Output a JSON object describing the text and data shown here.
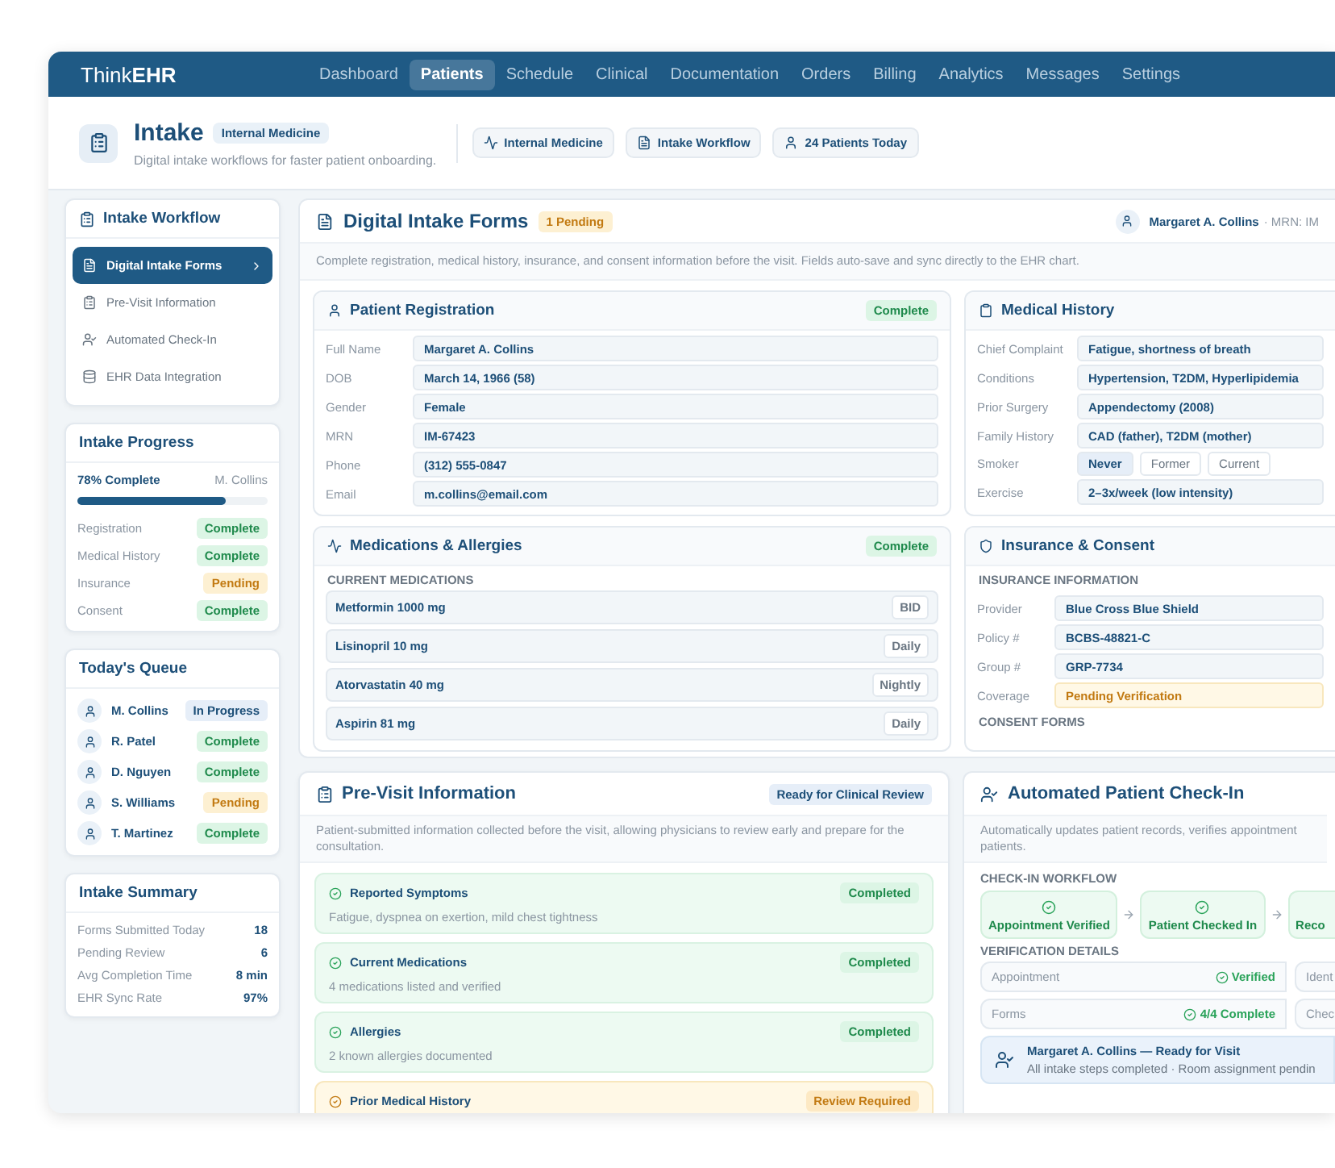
{
  "brand": "Think**EHR**",
  "nav": [
    {
      "label": "Dashboard",
      "selected": false
    },
    {
      "label": "Patients",
      "selected": true
    },
    {
      "label": "Schedule",
      "selected": false
    },
    {
      "label": "Clinical",
      "selected": false
    },
    {
      "label": "Documentation",
      "selected": false
    },
    {
      "label": "Orders",
      "selected": false
    },
    {
      "label": "Billing",
      "selected": false
    },
    {
      "label": "Analytics",
      "selected": false
    },
    {
      "label": "Messages",
      "selected": false
    },
    {
      "label": "Settings",
      "selected": false
    }
  ],
  "header": {
    "title": "Intake",
    "badge": "Internal Medicine",
    "subtitle": "Digital intake workflows for faster patient onboarding.",
    "pills": [
      {
        "kind": "pulse",
        "label": "Internal Medicine"
      },
      {
        "kind": "document",
        "label": "Intake Workflow"
      },
      {
        "kind": "person",
        "label": "24 Patients Today"
      }
    ]
  },
  "sidebar": {
    "workflow": {
      "title": "Intake Workflow",
      "items": [
        {
          "kind": "document",
          "label": "Digital Intake Forms",
          "selected": true
        },
        {
          "kind": "clipboard",
          "label": "Pre-Visit Information",
          "selected": false
        },
        {
          "kind": "checkin",
          "label": "Automated Check-In",
          "selected": false
        },
        {
          "kind": "database",
          "label": "EHR Data Integration",
          "selected": false
        }
      ]
    },
    "progress": {
      "title": "Intake Progress",
      "percent": "78% Complete",
      "patient": "M. Collins",
      "level": 0.78,
      "steps": [
        {
          "label": "Registration",
          "status": "Complete",
          "kind": "complete"
        },
        {
          "label": "Medical History",
          "status": "Complete",
          "kind": "complete"
        },
        {
          "label": "Insurance",
          "status": "Pending",
          "kind": "pending"
        },
        {
          "label": "Consent",
          "status": "Complete",
          "kind": "complete"
        }
      ]
    },
    "queue": {
      "title": "Today's Queue",
      "patients": [
        {
          "name": "M. Collins",
          "status": "In Progress",
          "kind": "progress"
        },
        {
          "name": "R. Patel",
          "status": "Complete",
          "kind": "complete"
        },
        {
          "name": "D. Nguyen",
          "status": "Complete",
          "kind": "complete"
        },
        {
          "name": "S. Williams",
          "status": "Pending",
          "kind": "pending"
        },
        {
          "name": "T. Martinez",
          "status": "Complete",
          "kind": "complete"
        }
      ]
    },
    "summary": {
      "title": "Intake Summary",
      "rows": [
        {
          "label": "Forms Submitted Today",
          "value": "18"
        },
        {
          "label": "Pending Review",
          "value": "6"
        },
        {
          "label": "Avg Completion Time",
          "value": "8 min"
        },
        {
          "label": "EHR Sync Rate",
          "value": "97%"
        }
      ]
    }
  },
  "intake_forms": {
    "title": "Digital Intake Forms",
    "badge": "1 Pending",
    "patient": "Margaret A. Collins",
    "mrn": "· MRN: IM",
    "description": "Complete registration, medical history, insurance, and consent information before the visit. Fields auto-save and sync directly to the EHR chart.",
    "registration": {
      "title": "Patient Registration",
      "status": "Complete",
      "fields": [
        {
          "label": "Full Name",
          "value": "Margaret A. Collins"
        },
        {
          "label": "DOB",
          "value": "March 14, 1966 (58)"
        },
        {
          "label": "Gender",
          "value": "Female"
        },
        {
          "label": "MRN",
          "value": "IM-67423"
        },
        {
          "label": "Phone",
          "value": "(312) 555-0847"
        },
        {
          "label": "Email",
          "value": "m.collins@email.com"
        }
      ]
    },
    "medical_history": {
      "title": "Medical History",
      "fields": [
        {
          "kind": "text",
          "label": "Chief Complaint",
          "value": "Fatigue, shortness of breath"
        },
        {
          "kind": "text",
          "label": "Conditions",
          "value": "Hypertension, T2DM, Hyperlipidemia"
        },
        {
          "kind": "text",
          "label": "Prior Surgery",
          "value": "Appendectomy (2008)"
        },
        {
          "kind": "text",
          "label": "Family History",
          "value": "CAD (father), T2DM (mother)"
        },
        {
          "kind": "options",
          "label": "Smoker",
          "options": [
            {
              "label": "Never",
              "selected": true
            },
            {
              "label": "Former",
              "selected": false
            },
            {
              "label": "Current",
              "selected": false
            }
          ]
        },
        {
          "kind": "text",
          "label": "Exercise",
          "value": "2–3x/week (low intensity)"
        }
      ]
    },
    "medications": {
      "title": "Medications & Allergies",
      "status": "Complete",
      "section": "CURRENT MEDICATIONS",
      "items": [
        {
          "name": "Metformin 1000 mg",
          "frequency": "BID"
        },
        {
          "name": "Lisinopril 10 mg",
          "frequency": "Daily"
        },
        {
          "name": "Atorvastatin 40 mg",
          "frequency": "Nightly"
        },
        {
          "name": "Aspirin 81 mg",
          "frequency": "Daily"
        }
      ]
    },
    "insurance": {
      "title": "Insurance & Consent",
      "section": "INSURANCE INFORMATION",
      "fields": [
        {
          "kind": "text",
          "label": "Provider",
          "value": "Blue Cross Blue Shield"
        },
        {
          "kind": "text",
          "label": "Policy #",
          "value": "BCBS-48821-C"
        },
        {
          "kind": "text",
          "label": "Group #",
          "value": "GRP-7734"
        },
        {
          "kind": "warning",
          "label": "Coverage",
          "value": "Pending Verification"
        }
      ],
      "consent_section": "CONSENT FORMS"
    }
  },
  "pre_visit": {
    "title": "Pre-Visit Information",
    "badge": "Ready for Clinical Review",
    "description": "Patient-submitted information collected before the visit, allowing physicians to review early and prepare for the consultation.",
    "items": [
      {
        "kind": "complete",
        "title": "Reported Symptoms",
        "detail": "Fatigue, dyspnea on exertion, mild chest tightness",
        "status": "Completed"
      },
      {
        "kind": "complete",
        "title": "Current Medications",
        "detail": "4 medications listed and verified",
        "status": "Completed"
      },
      {
        "kind": "complete",
        "title": "Allergies",
        "detail": "2 known allergies documented",
        "status": "Completed"
      },
      {
        "kind": "review",
        "title": "Prior Medical History",
        "status": "Review Required"
      }
    ]
  },
  "check_in": {
    "title": "Automated Patient Check-In",
    "description": "Automatically updates patient records, verifies appointment patients.",
    "workflow_section": "CHECK-IN WORKFLOW",
    "steps": [
      {
        "kind": "done",
        "label": "Appointment Verified"
      },
      {
        "kind": "done",
        "label": "Patient Checked In"
      },
      {
        "kind": "partial",
        "label": "Reco"
      }
    ],
    "details_section": "VERIFICATION DETAILS",
    "details": [
      {
        "kind": "verified",
        "label": "Appointment",
        "value": "Verified"
      },
      {
        "kind": "plain",
        "label": "Ident"
      },
      {
        "kind": "verified",
        "label": "Forms",
        "value": "4/4 Complete"
      },
      {
        "kind": "plain",
        "label": "Chec"
      }
    ],
    "banner": {
      "title": "Margaret A. Collins — Ready for Visit",
      "detail": "All intake steps completed · Room assignment pendin"
    }
  }
}
